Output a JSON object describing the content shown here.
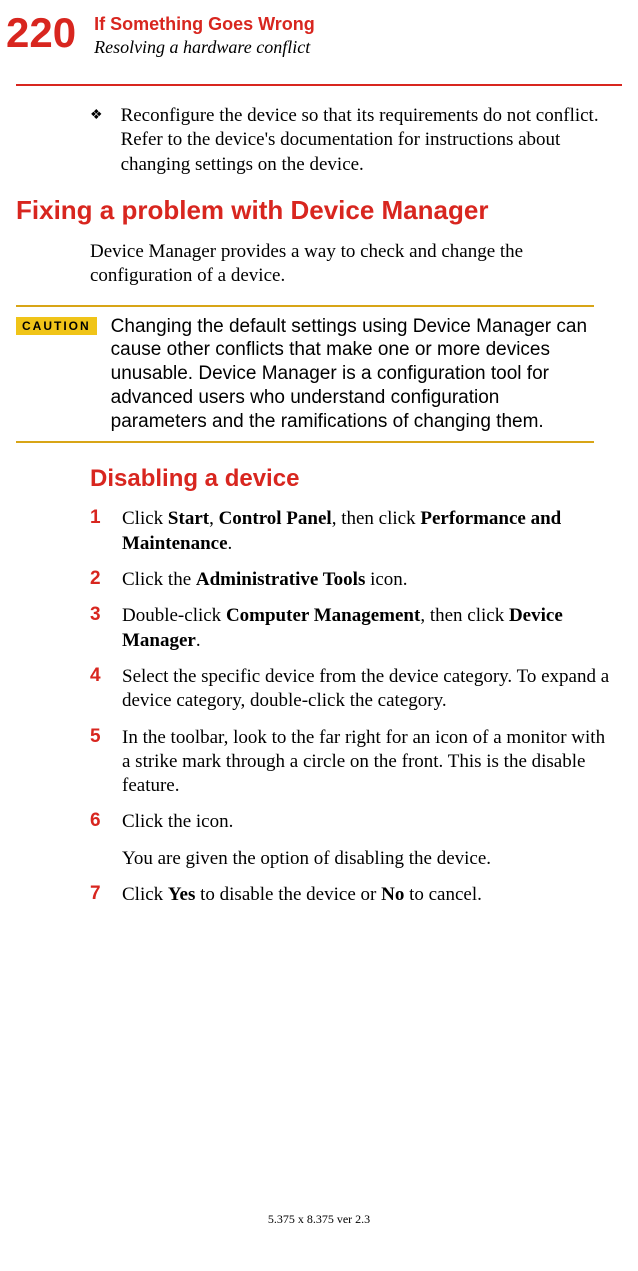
{
  "header": {
    "page_number": "220",
    "chapter": "If Something Goes Wrong",
    "section": "Resolving a hardware conflict"
  },
  "bullet": {
    "glyph": "❖",
    "text": "Reconfigure the device so that its requirements do not conflict. Refer to the device's documentation for instructions about changing settings on the device."
  },
  "h1": "Fixing a problem with Device Manager",
  "intro": "Device Manager provides a way to check and change the configuration of a device.",
  "caution": {
    "label": "CAUTION",
    "text": "Changing the default settings using Device Manager can cause other conflicts that make one or more devices unusable. Device Manager is a configuration tool for advanced users who understand configuration parameters and the ramifications of changing them."
  },
  "h2": "Disabling a device",
  "steps": [
    {
      "n": "1",
      "pre": "Click ",
      "b1": "Start",
      "mid1": ", ",
      "b2": "Control Panel",
      "mid2": ", then click ",
      "b3": "Performance and Maintenance",
      "post": "."
    },
    {
      "n": "2",
      "pre": "Click the ",
      "b1": "Administrative Tools",
      "post": " icon."
    },
    {
      "n": "3",
      "pre": "Double-click ",
      "b1": "Computer Management",
      "mid1": ", then click ",
      "b2": "Device Manager",
      "post": "."
    },
    {
      "n": "4",
      "plain": "Select the specific device from the device category. To expand a device category, double-click the category."
    },
    {
      "n": "5",
      "plain": "In the toolbar, look to the far right for an icon of a monitor with a strike mark through a circle on the front. This is the disable feature."
    },
    {
      "n": "6",
      "plain": "Click the icon."
    },
    {
      "n": "7",
      "pre": "Click ",
      "b1": "Yes",
      "mid1": " to disable the device or ",
      "b2": "No",
      "post": " to cancel."
    }
  ],
  "step6_cont": "You are given the option of disabling the device.",
  "footer": "5.375 x 8.375 ver 2.3"
}
